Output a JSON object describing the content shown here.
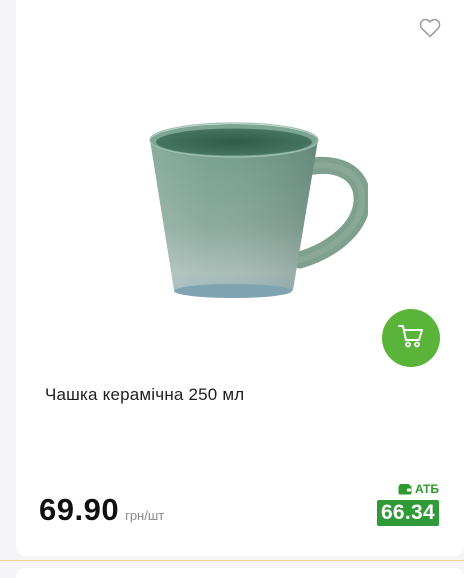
{
  "product": {
    "title": "Чашка керамічна 250 мл",
    "image_icon": "ceramic-mug-image",
    "price": "69.90",
    "unit": "грн/шт",
    "club_label": "АТБ",
    "club_price": "66.34"
  },
  "icons": {
    "favorite": "heart-outline-icon",
    "cart": "shopping-cart-icon",
    "club": "wallet-icon"
  },
  "colors": {
    "accent_green": "#5bb43a",
    "club_green": "#2f9a37",
    "mug_green": "#6e9a86"
  }
}
